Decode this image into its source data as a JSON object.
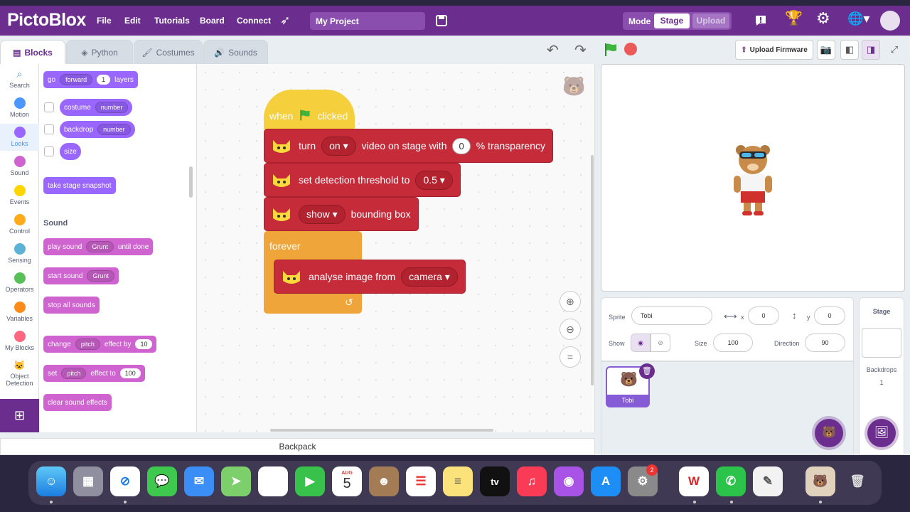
{
  "app": {
    "name": "PictoBlox"
  },
  "menu": [
    "File",
    "Edit",
    "Tutorials",
    "Board",
    "Connect"
  ],
  "project_name": "My Project",
  "mode": {
    "label": "Mode",
    "stage": "Stage",
    "upload": "Upload"
  },
  "tabs": [
    {
      "label": "Blocks"
    },
    {
      "label": "Python"
    },
    {
      "label": "Costumes"
    },
    {
      "label": "Sounds"
    }
  ],
  "upload_firmware": "Upload Firmware",
  "categories": [
    {
      "label": "Search",
      "color": "#4c97ff"
    },
    {
      "label": "Motion",
      "color": "#4c97ff"
    },
    {
      "label": "Looks",
      "color": "#9966ff"
    },
    {
      "label": "Sound",
      "color": "#cf63cf"
    },
    {
      "label": "Events",
      "color": "#ffd500"
    },
    {
      "label": "Control",
      "color": "#ffab19"
    },
    {
      "label": "Sensing",
      "color": "#5cb1d6"
    },
    {
      "label": "Operators",
      "color": "#59c059"
    },
    {
      "label": "Variables",
      "color": "#ff8c1a"
    },
    {
      "label": "My Blocks",
      "color": "#ff6680"
    },
    {
      "label": "Object Detection",
      "color": "#ffd93b"
    }
  ],
  "palette": {
    "go_layers": {
      "t1": "go",
      "dd": "forward",
      "val": "1",
      "t2": "layers"
    },
    "costume": {
      "t": "costume",
      "dd": "number"
    },
    "backdrop": {
      "t": "backdrop",
      "dd": "number"
    },
    "size": "size",
    "snapshot": "take stage snapshot",
    "sound_heading": "Sound",
    "play_sound": {
      "t1": "play sound",
      "dd": "Grunt",
      "t2": "until done"
    },
    "start_sound": {
      "t": "start sound",
      "dd": "Grunt"
    },
    "stop_sounds": "stop all sounds",
    "change_effect": {
      "t1": "change",
      "dd": "pitch",
      "t2": "effect by",
      "val": "10"
    },
    "set_effect": {
      "t1": "set",
      "dd": "pitch",
      "t2": "effect to",
      "val": "100"
    },
    "clear_effects": "clear sound effects"
  },
  "script": {
    "hat": {
      "t1": "when",
      "t2": "clicked"
    },
    "video": {
      "t1": "turn",
      "dd": "on",
      "t2": "video on stage with",
      "val": "0",
      "t3": "% transparency"
    },
    "threshold": {
      "t": "set detection threshold to",
      "dd": "0.5"
    },
    "bbox": {
      "dd": "show",
      "t": "bounding box"
    },
    "forever": "forever",
    "analyse": {
      "t": "analyse image from",
      "dd": "camera"
    }
  },
  "backpack": "Backpack",
  "sprite": {
    "label": "Sprite",
    "name": "Tobi",
    "x_label": "x",
    "x": "0",
    "y_label": "y",
    "y": "0",
    "show_label": "Show",
    "size_label": "Size",
    "size": "100",
    "direction_label": "Direction",
    "direction": "90"
  },
  "sprite_card": "Tobi",
  "stage_panel": {
    "title": "Stage",
    "backdrops_label": "Backdrops",
    "backdrops_count": "1"
  },
  "dock": {
    "calendar_month": "AUG",
    "calendar_day": "5",
    "settings_badge": "2",
    "appletv": "tv"
  }
}
